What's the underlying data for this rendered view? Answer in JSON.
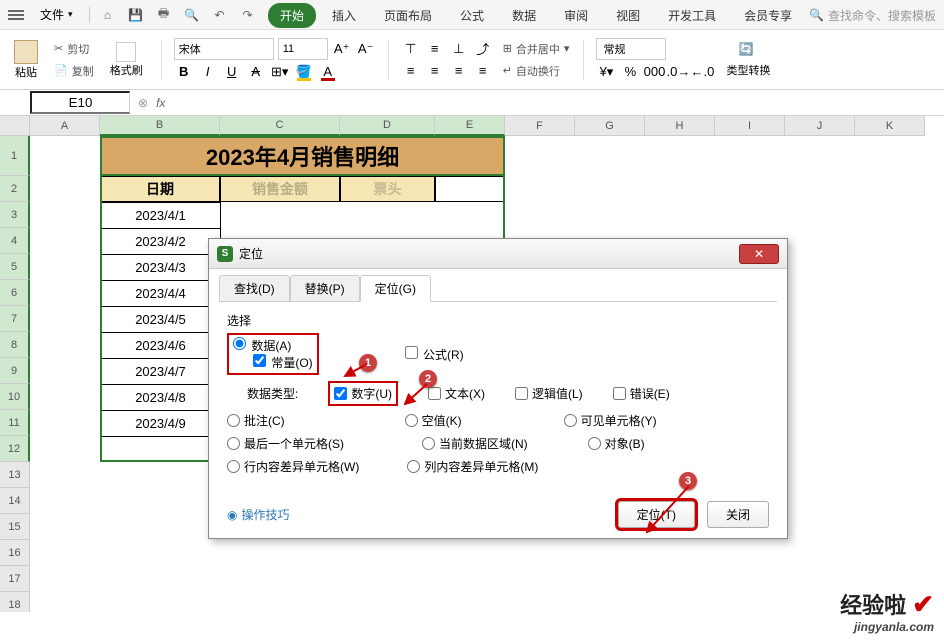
{
  "topbar": {
    "file_label": "文件",
    "search_placeholder": "查找命令、搜索模板"
  },
  "ribbon_tabs": [
    "开始",
    "插入",
    "页面布局",
    "公式",
    "数据",
    "审阅",
    "视图",
    "开发工具",
    "会员专享"
  ],
  "ribbon": {
    "paste": "粘贴",
    "cut": "剪切",
    "copy": "复制",
    "format_painter": "格式刷",
    "font": "宋体",
    "size": "11",
    "merge_center": "合并居中",
    "wrap": "自动换行",
    "number_format": "常规",
    "type_convert": "类型转换"
  },
  "namebox": "E10",
  "columns": [
    "A",
    "B",
    "C",
    "D",
    "E",
    "F",
    "G",
    "H",
    "I",
    "J",
    "K"
  ],
  "rows": [
    "1",
    "2",
    "3",
    "4",
    "5",
    "6",
    "7",
    "8",
    "9",
    "10",
    "11",
    "12",
    "13",
    "14",
    "15",
    "16",
    "17",
    "18"
  ],
  "sheet_title": "2023年4月销售明细",
  "headers": [
    "日期",
    "销售金额",
    "票头"
  ],
  "data": {
    "dates": [
      "2023/4/1",
      "2023/4/2",
      "2023/4/3",
      "2023/4/4",
      "2023/4/5",
      "2023/4/6",
      "2023/4/7",
      "2023/4/8",
      "2023/4/9"
    ]
  },
  "dialog": {
    "title": "定位",
    "tabs": {
      "find": "查找(D)",
      "replace": "替换(P)",
      "goto": "定位(G)"
    },
    "select_label": "选择",
    "opts": {
      "data": "数据(A)",
      "constant": "常量(O)",
      "formula": "公式(R)",
      "datatype_label": "数据类型:",
      "number": "数字(U)",
      "text": "文本(X)",
      "logical": "逻辑值(L)",
      "error": "错误(E)",
      "comment": "批注(C)",
      "blank": "空值(K)",
      "visible": "可见单元格(Y)",
      "last": "最后一个单元格(S)",
      "current_region": "当前数据区域(N)",
      "object": "对象(B)",
      "row_diff": "行内容差异单元格(W)",
      "col_diff": "列内容差异单元格(M)"
    },
    "help": "操作技巧",
    "ok": "定位(T)",
    "close": "关闭"
  },
  "callouts": {
    "c1": "1",
    "c2": "2",
    "c3": "3"
  },
  "watermark": {
    "line1": "经验啦",
    "line2": "jingyanla.com"
  }
}
